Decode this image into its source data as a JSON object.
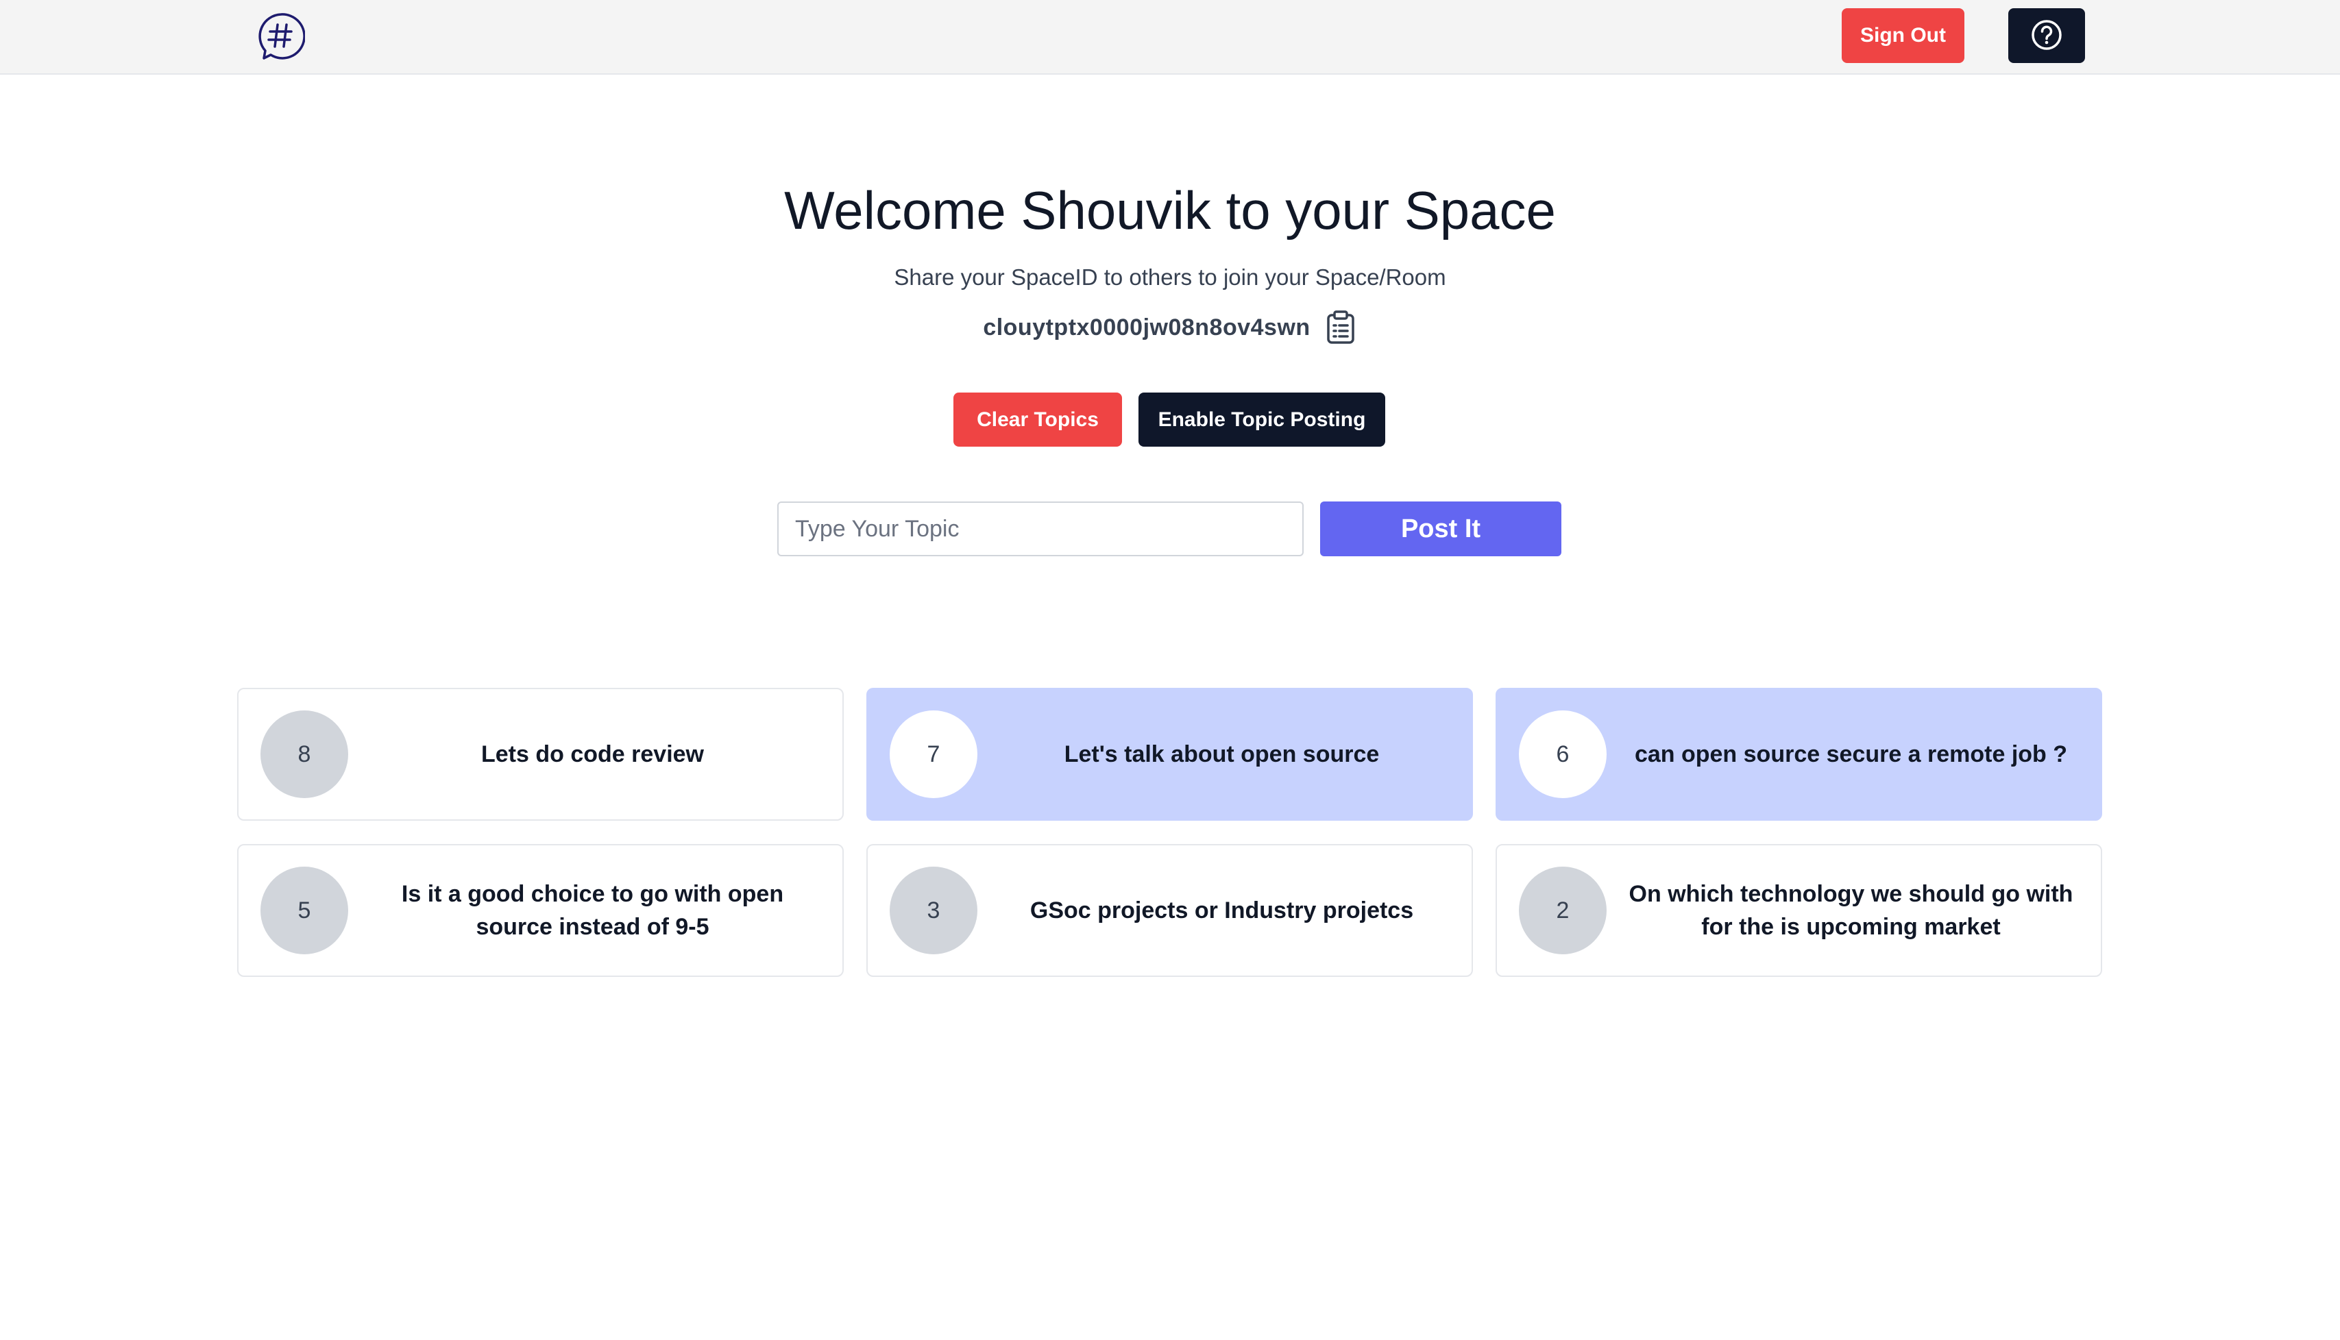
{
  "header": {
    "logo_icon": "hash-chat-bubble-icon",
    "signout_label": "Sign Out",
    "help_icon": "question-circle-icon",
    "colors": {
      "signout": "#ef4444",
      "help": "#0f172a",
      "bar": "#f4f4f4"
    }
  },
  "main": {
    "title": "Welcome Shouvik to your Space",
    "subtitle": "Share your SpaceID to others to join your Space/Room",
    "space_id": "clouytptx0000jw08n8ov4swn",
    "copy_icon": "clipboard-icon",
    "clear_label": "Clear Topics",
    "enable_label": "Enable Topic Posting",
    "topic_placeholder": "Type Your Topic",
    "post_label": "Post It",
    "colors": {
      "clear": "#ef4444",
      "enable": "#0f172a",
      "post": "#6366f1",
      "highlight": "#c7d2fe"
    }
  },
  "topics": [
    {
      "votes": "8",
      "text": "Lets do code review",
      "highlighted": false
    },
    {
      "votes": "7",
      "text": "Let's talk about open source",
      "highlighted": true
    },
    {
      "votes": "6",
      "text": "can open source secure a remote job ?",
      "highlighted": true
    },
    {
      "votes": "5",
      "text": "Is it a good choice to go with open source instead of 9-5",
      "highlighted": false
    },
    {
      "votes": "3",
      "text": "GSoc projects or Industry projetcs",
      "highlighted": false
    },
    {
      "votes": "2",
      "text": "On which technology we should go with for the is upcoming market",
      "highlighted": false
    }
  ]
}
